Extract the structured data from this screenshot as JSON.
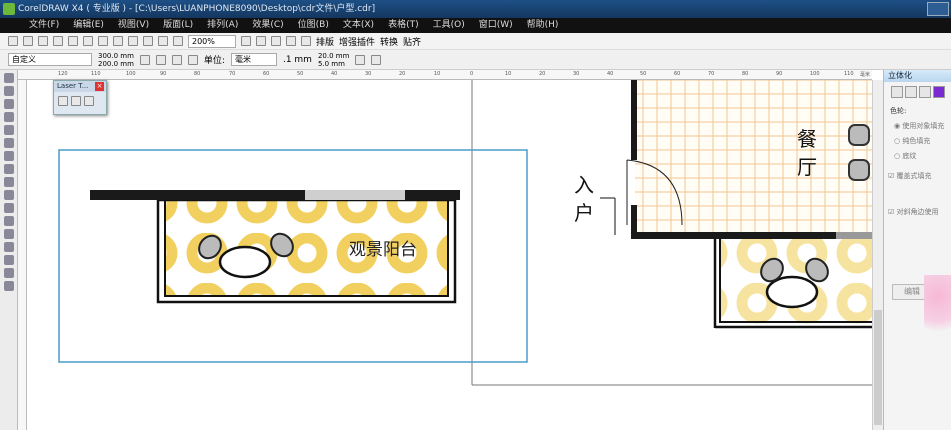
{
  "window": {
    "title": "CorelDRAW X4 ( 专业版 ) - [C:\\Users\\LUANPHONE8090\\Desktop\\cdr文件\\户型.cdr]"
  },
  "menu": [
    "文件(F)",
    "编辑(E)",
    "视图(V)",
    "版面(L)",
    "排列(A)",
    "效果(C)",
    "位图(B)",
    "文本(X)",
    "表格(T)",
    "工具(O)",
    "窗口(W)",
    "帮助(H)"
  ],
  "toolbar": {
    "zoom": "200%",
    "buttons": [
      "排版",
      "增强插件",
      "转换",
      "贴齐"
    ]
  },
  "propbar": {
    "paper": "自定义",
    "width": "300.0 mm",
    "height": "200.0 mm",
    "unit_label": "单位:",
    "unit": "毫米",
    "nudge": ".1 mm",
    "dup_x": "20.0 mm",
    "dup_y": "5.0 mm"
  },
  "ruler": {
    "ticks": [
      "120",
      "110",
      "100",
      "90",
      "80",
      "70",
      "60",
      "50",
      "40",
      "30",
      "20",
      "10",
      "0",
      "10",
      "20",
      "30",
      "40",
      "50",
      "60",
      "70",
      "80",
      "90",
      "100",
      "110"
    ],
    "unit": "毫米"
  },
  "laser_toolbar": {
    "title": "Laser T..."
  },
  "docker": {
    "title": "立体化",
    "color_label": "色轮:",
    "options": [
      "使用对象填充",
      "纯色填充",
      "底纹"
    ],
    "checks": [
      "覆盖式填充",
      "对斜角边使用"
    ],
    "edit": "编辑"
  },
  "drawing": {
    "balcony_label": "观景阳台",
    "dining_label": "餐厅",
    "entry_label": "入户"
  }
}
